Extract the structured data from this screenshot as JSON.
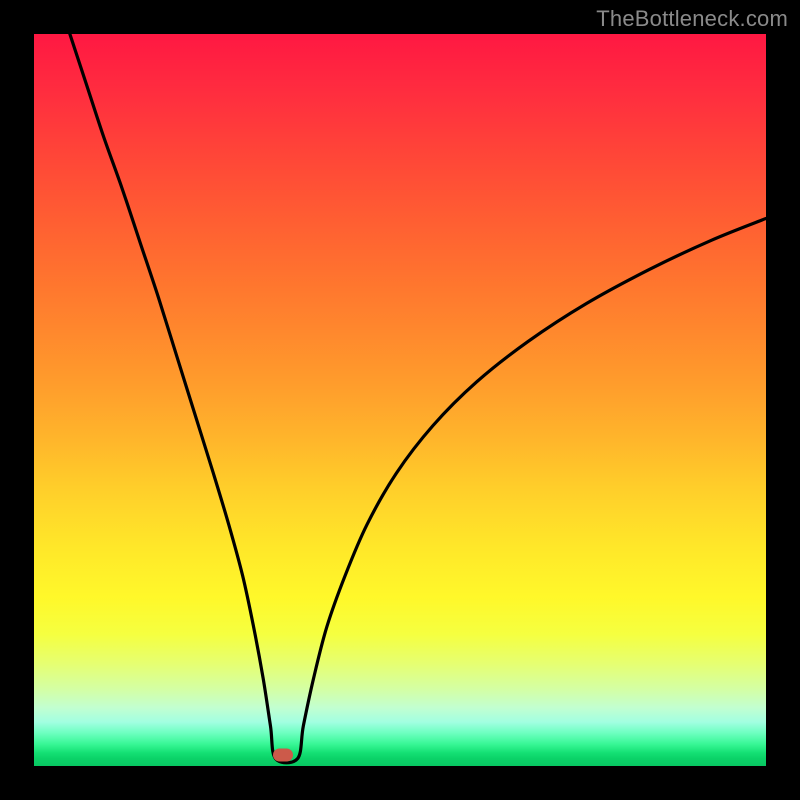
{
  "watermark": "TheBottleneck.com",
  "colors": {
    "curve": "#000000",
    "dot": "#cc5a4a",
    "frame": "#000000"
  },
  "dot": {
    "x_frac": 0.34,
    "y_frac": 0.985
  },
  "chart_data": {
    "type": "line",
    "title": "",
    "xlabel": "",
    "ylabel": "",
    "xlim": [
      0,
      1
    ],
    "ylim": [
      0,
      1
    ],
    "grid": false,
    "series": [
      {
        "name": "bottleneck-curve",
        "points": [
          {
            "x": 0.049,
            "y": 1.0
          },
          {
            "x": 0.072,
            "y": 0.93
          },
          {
            "x": 0.095,
            "y": 0.86
          },
          {
            "x": 0.12,
            "y": 0.79
          },
          {
            "x": 0.145,
            "y": 0.715
          },
          {
            "x": 0.17,
            "y": 0.64
          },
          {
            "x": 0.195,
            "y": 0.56
          },
          {
            "x": 0.22,
            "y": 0.48
          },
          {
            "x": 0.245,
            "y": 0.4
          },
          {
            "x": 0.266,
            "y": 0.33
          },
          {
            "x": 0.285,
            "y": 0.26
          },
          {
            "x": 0.3,
            "y": 0.19
          },
          {
            "x": 0.313,
            "y": 0.12
          },
          {
            "x": 0.323,
            "y": 0.055
          },
          {
            "x": 0.33,
            "y": 0.01
          },
          {
            "x": 0.36,
            "y": 0.01
          },
          {
            "x": 0.368,
            "y": 0.055
          },
          {
            "x": 0.382,
            "y": 0.12
          },
          {
            "x": 0.4,
            "y": 0.19
          },
          {
            "x": 0.425,
            "y": 0.26
          },
          {
            "x": 0.455,
            "y": 0.33
          },
          {
            "x": 0.495,
            "y": 0.4
          },
          {
            "x": 0.545,
            "y": 0.465
          },
          {
            "x": 0.605,
            "y": 0.525
          },
          {
            "x": 0.675,
            "y": 0.58
          },
          {
            "x": 0.755,
            "y": 0.632
          },
          {
            "x": 0.84,
            "y": 0.678
          },
          {
            "x": 0.925,
            "y": 0.718
          },
          {
            "x": 1.0,
            "y": 0.748
          }
        ]
      }
    ],
    "marker": {
      "x": 0.34,
      "y": 0.015
    }
  }
}
